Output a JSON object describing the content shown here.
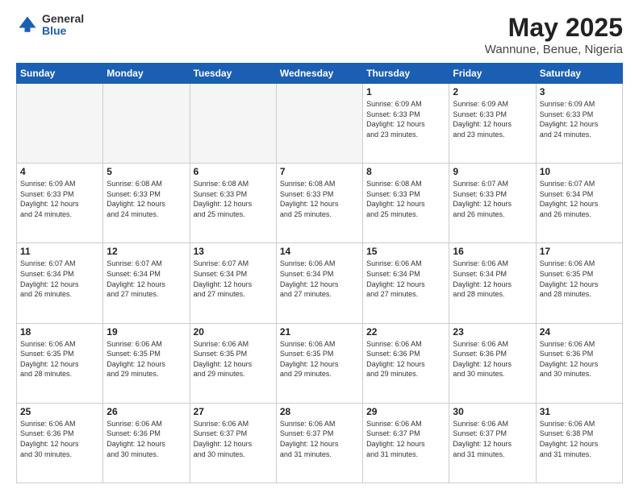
{
  "logo": {
    "general": "General",
    "blue": "Blue"
  },
  "header": {
    "title": "May 2025",
    "subtitle": "Wannune, Benue, Nigeria"
  },
  "calendar": {
    "days_of_week": [
      "Sunday",
      "Monday",
      "Tuesday",
      "Wednesday",
      "Thursday",
      "Friday",
      "Saturday"
    ],
    "weeks": [
      [
        {
          "day": "",
          "info": "",
          "empty": true
        },
        {
          "day": "",
          "info": "",
          "empty": true
        },
        {
          "day": "",
          "info": "",
          "empty": true
        },
        {
          "day": "",
          "info": "",
          "empty": true
        },
        {
          "day": "1",
          "info": "Sunrise: 6:09 AM\nSunset: 6:33 PM\nDaylight: 12 hours\nand 23 minutes.",
          "empty": false
        },
        {
          "day": "2",
          "info": "Sunrise: 6:09 AM\nSunset: 6:33 PM\nDaylight: 12 hours\nand 23 minutes.",
          "empty": false
        },
        {
          "day": "3",
          "info": "Sunrise: 6:09 AM\nSunset: 6:33 PM\nDaylight: 12 hours\nand 24 minutes.",
          "empty": false
        }
      ],
      [
        {
          "day": "4",
          "info": "Sunrise: 6:09 AM\nSunset: 6:33 PM\nDaylight: 12 hours\nand 24 minutes.",
          "empty": false
        },
        {
          "day": "5",
          "info": "Sunrise: 6:08 AM\nSunset: 6:33 PM\nDaylight: 12 hours\nand 24 minutes.",
          "empty": false
        },
        {
          "day": "6",
          "info": "Sunrise: 6:08 AM\nSunset: 6:33 PM\nDaylight: 12 hours\nand 25 minutes.",
          "empty": false
        },
        {
          "day": "7",
          "info": "Sunrise: 6:08 AM\nSunset: 6:33 PM\nDaylight: 12 hours\nand 25 minutes.",
          "empty": false
        },
        {
          "day": "8",
          "info": "Sunrise: 6:08 AM\nSunset: 6:33 PM\nDaylight: 12 hours\nand 25 minutes.",
          "empty": false
        },
        {
          "day": "9",
          "info": "Sunrise: 6:07 AM\nSunset: 6:33 PM\nDaylight: 12 hours\nand 26 minutes.",
          "empty": false
        },
        {
          "day": "10",
          "info": "Sunrise: 6:07 AM\nSunset: 6:34 PM\nDaylight: 12 hours\nand 26 minutes.",
          "empty": false
        }
      ],
      [
        {
          "day": "11",
          "info": "Sunrise: 6:07 AM\nSunset: 6:34 PM\nDaylight: 12 hours\nand 26 minutes.",
          "empty": false
        },
        {
          "day": "12",
          "info": "Sunrise: 6:07 AM\nSunset: 6:34 PM\nDaylight: 12 hours\nand 27 minutes.",
          "empty": false
        },
        {
          "day": "13",
          "info": "Sunrise: 6:07 AM\nSunset: 6:34 PM\nDaylight: 12 hours\nand 27 minutes.",
          "empty": false
        },
        {
          "day": "14",
          "info": "Sunrise: 6:06 AM\nSunset: 6:34 PM\nDaylight: 12 hours\nand 27 minutes.",
          "empty": false
        },
        {
          "day": "15",
          "info": "Sunrise: 6:06 AM\nSunset: 6:34 PM\nDaylight: 12 hours\nand 27 minutes.",
          "empty": false
        },
        {
          "day": "16",
          "info": "Sunrise: 6:06 AM\nSunset: 6:34 PM\nDaylight: 12 hours\nand 28 minutes.",
          "empty": false
        },
        {
          "day": "17",
          "info": "Sunrise: 6:06 AM\nSunset: 6:35 PM\nDaylight: 12 hours\nand 28 minutes.",
          "empty": false
        }
      ],
      [
        {
          "day": "18",
          "info": "Sunrise: 6:06 AM\nSunset: 6:35 PM\nDaylight: 12 hours\nand 28 minutes.",
          "empty": false
        },
        {
          "day": "19",
          "info": "Sunrise: 6:06 AM\nSunset: 6:35 PM\nDaylight: 12 hours\nand 29 minutes.",
          "empty": false
        },
        {
          "day": "20",
          "info": "Sunrise: 6:06 AM\nSunset: 6:35 PM\nDaylight: 12 hours\nand 29 minutes.",
          "empty": false
        },
        {
          "day": "21",
          "info": "Sunrise: 6:06 AM\nSunset: 6:35 PM\nDaylight: 12 hours\nand 29 minutes.",
          "empty": false
        },
        {
          "day": "22",
          "info": "Sunrise: 6:06 AM\nSunset: 6:36 PM\nDaylight: 12 hours\nand 29 minutes.",
          "empty": false
        },
        {
          "day": "23",
          "info": "Sunrise: 6:06 AM\nSunset: 6:36 PM\nDaylight: 12 hours\nand 30 minutes.",
          "empty": false
        },
        {
          "day": "24",
          "info": "Sunrise: 6:06 AM\nSunset: 6:36 PM\nDaylight: 12 hours\nand 30 minutes.",
          "empty": false
        }
      ],
      [
        {
          "day": "25",
          "info": "Sunrise: 6:06 AM\nSunset: 6:36 PM\nDaylight: 12 hours\nand 30 minutes.",
          "empty": false
        },
        {
          "day": "26",
          "info": "Sunrise: 6:06 AM\nSunset: 6:36 PM\nDaylight: 12 hours\nand 30 minutes.",
          "empty": false
        },
        {
          "day": "27",
          "info": "Sunrise: 6:06 AM\nSunset: 6:37 PM\nDaylight: 12 hours\nand 30 minutes.",
          "empty": false
        },
        {
          "day": "28",
          "info": "Sunrise: 6:06 AM\nSunset: 6:37 PM\nDaylight: 12 hours\nand 31 minutes.",
          "empty": false
        },
        {
          "day": "29",
          "info": "Sunrise: 6:06 AM\nSunset: 6:37 PM\nDaylight: 12 hours\nand 31 minutes.",
          "empty": false
        },
        {
          "day": "30",
          "info": "Sunrise: 6:06 AM\nSunset: 6:37 PM\nDaylight: 12 hours\nand 31 minutes.",
          "empty": false
        },
        {
          "day": "31",
          "info": "Sunrise: 6:06 AM\nSunset: 6:38 PM\nDaylight: 12 hours\nand 31 minutes.",
          "empty": false
        }
      ]
    ]
  }
}
